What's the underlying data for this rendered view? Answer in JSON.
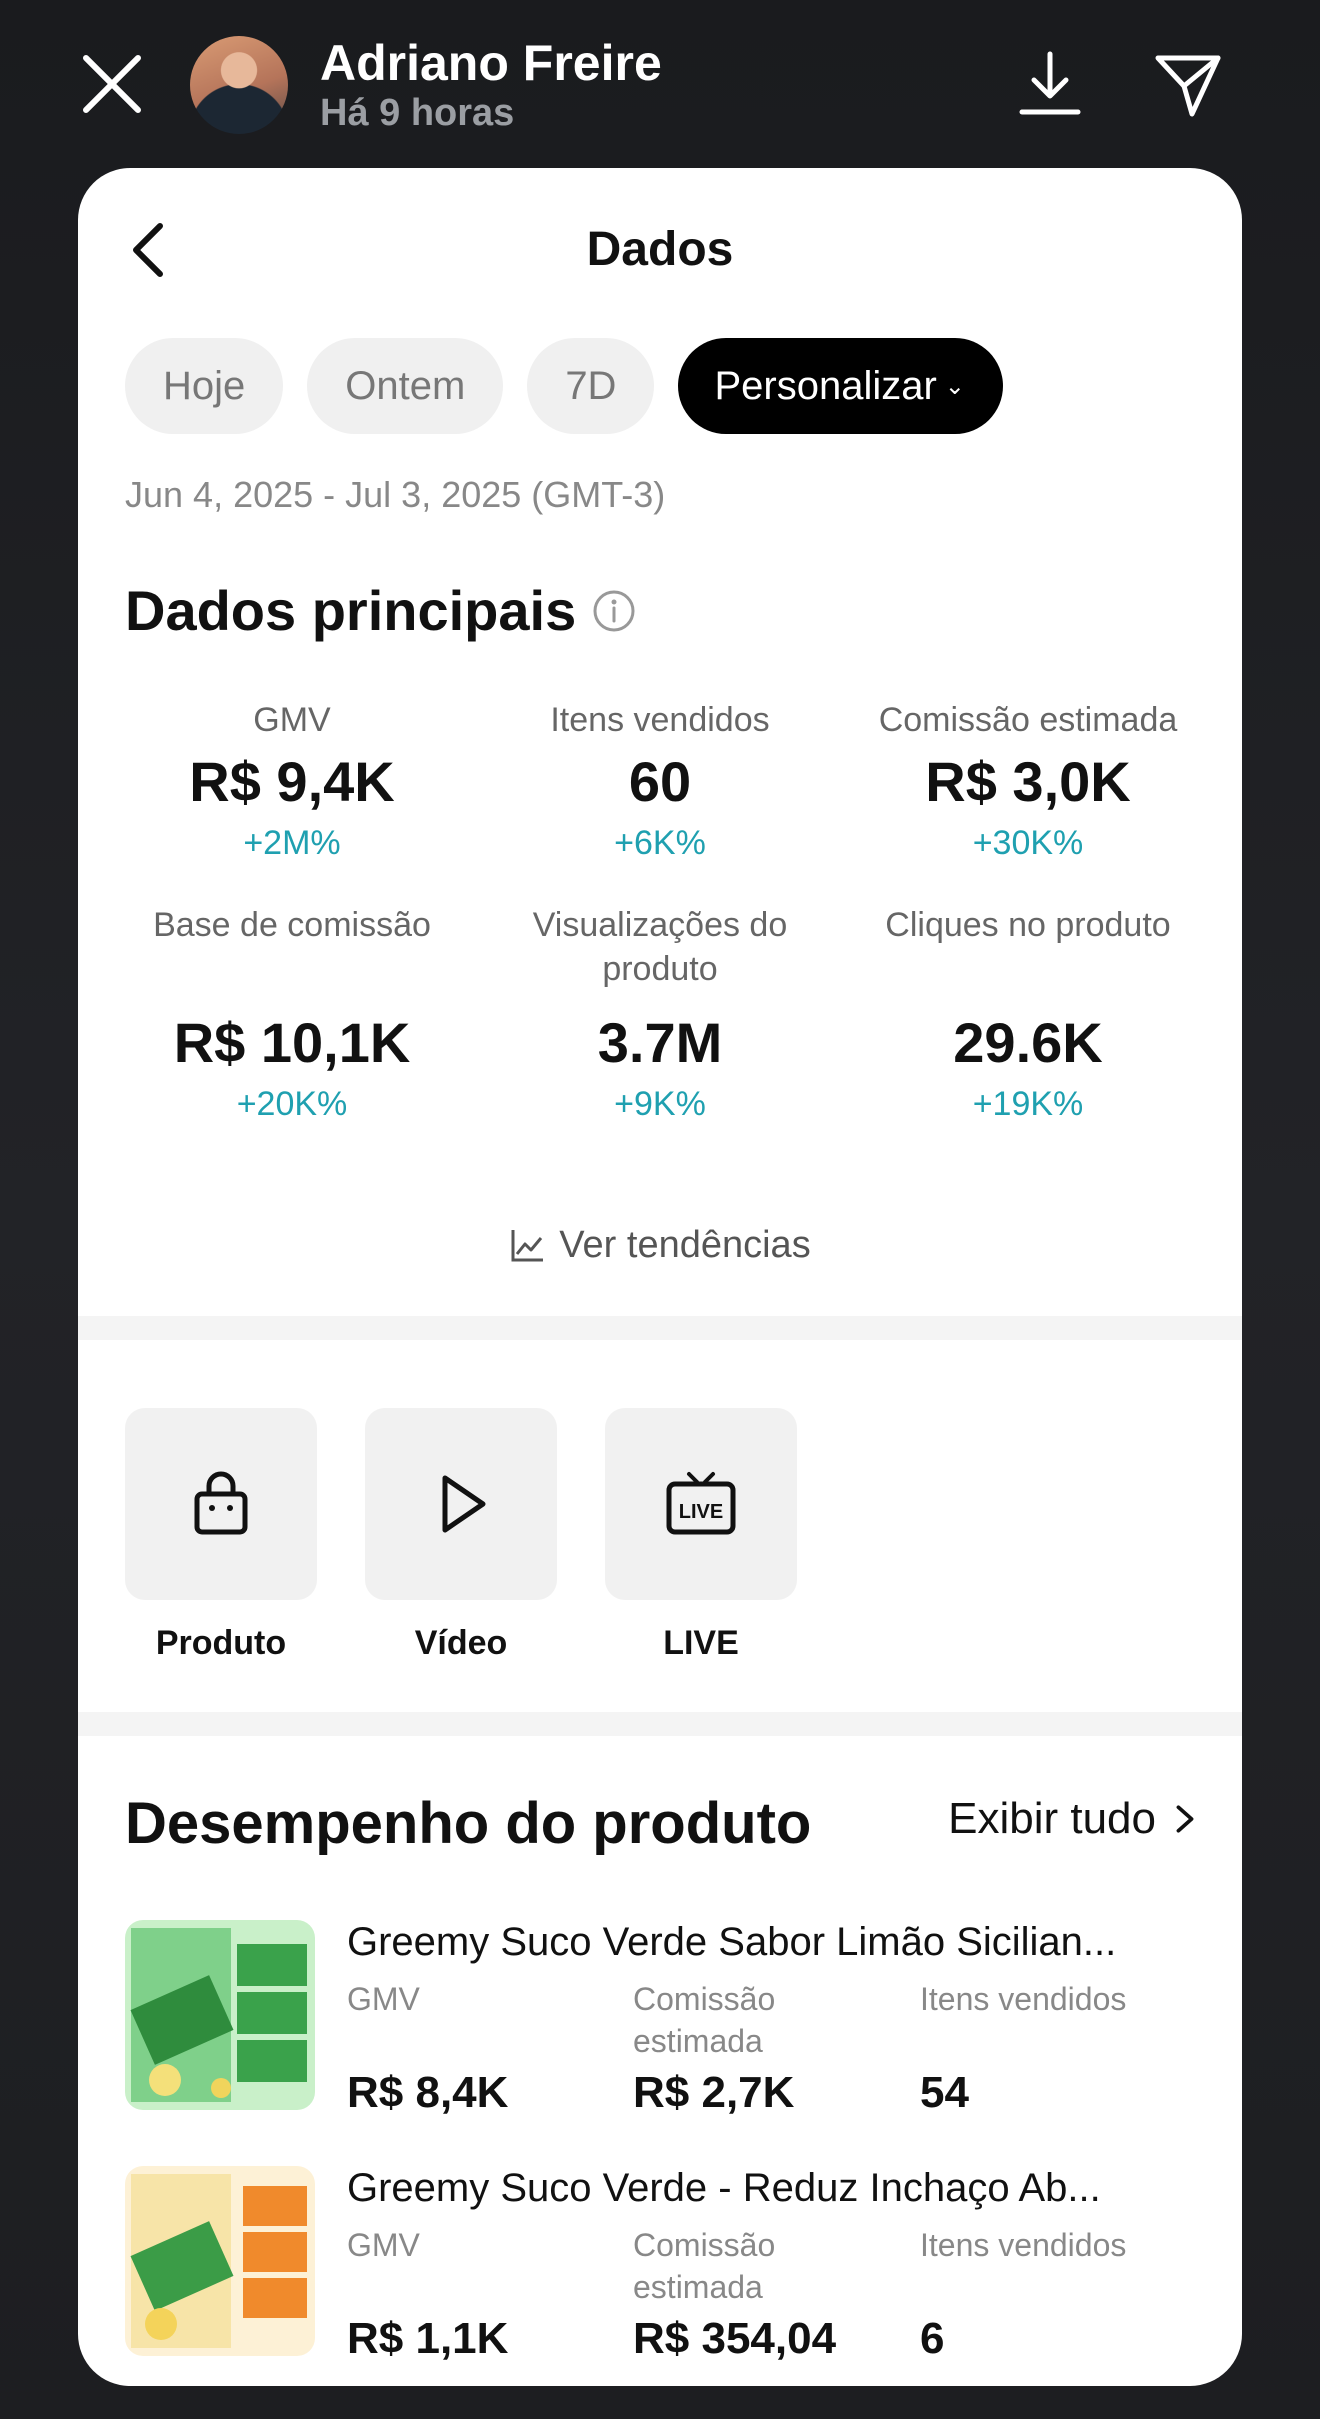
{
  "story": {
    "user_name": "Adriano Freire",
    "time": "Há 9 horas"
  },
  "screen": {
    "title": "Dados",
    "chips": [
      "Hoje",
      "Ontem",
      "7D",
      "Personalizar"
    ],
    "active_chip": "Personalizar",
    "date_range": "Jun 4, 2025 - Jul 3, 2025 (GMT-3)"
  },
  "main_data": {
    "title": "Dados principais",
    "metrics": [
      {
        "label": "GMV",
        "value": "R$ 9,4K",
        "delta": "+2M%"
      },
      {
        "label": "Itens vendidos",
        "value": "60",
        "delta": "+6K%"
      },
      {
        "label": "Comissão estimada",
        "value": "R$ 3,0K",
        "delta": "+30K%"
      },
      {
        "label": "Base de comissão",
        "value": "R$ 10,1K",
        "delta": "+20K%"
      },
      {
        "label": "Visualizações do produto",
        "value": "3.7M",
        "delta": "+9K%"
      },
      {
        "label": "Cliques no produto",
        "value": "29.6K",
        "delta": "+19K%"
      }
    ],
    "trend_link": "Ver tendências"
  },
  "tiles": [
    {
      "label": "Produto",
      "icon": "shopping-bag-icon"
    },
    {
      "label": "Vídeo",
      "icon": "play-icon"
    },
    {
      "label": "LIVE",
      "icon": "live-tv-icon"
    }
  ],
  "performance": {
    "title": "Desempenho do produto",
    "see_all": "Exibir tudo",
    "col_labels": [
      "GMV",
      "Comissão estimada",
      "Itens vendidos"
    ],
    "products": [
      {
        "name": "Greemy Suco Verde Sabor Limão Sicilian...",
        "gmv": "R$ 8,4K",
        "commission": "R$ 2,7K",
        "items": "54"
      },
      {
        "name": "Greemy Suco Verde - Reduz Inchaço Ab...",
        "gmv": "R$ 1,1K",
        "commission": "R$ 354,04",
        "items": "6"
      }
    ]
  },
  "colors": {
    "accent_delta": "#1fa0b0",
    "chip_active": "#000000",
    "background": "#1c1d20"
  }
}
